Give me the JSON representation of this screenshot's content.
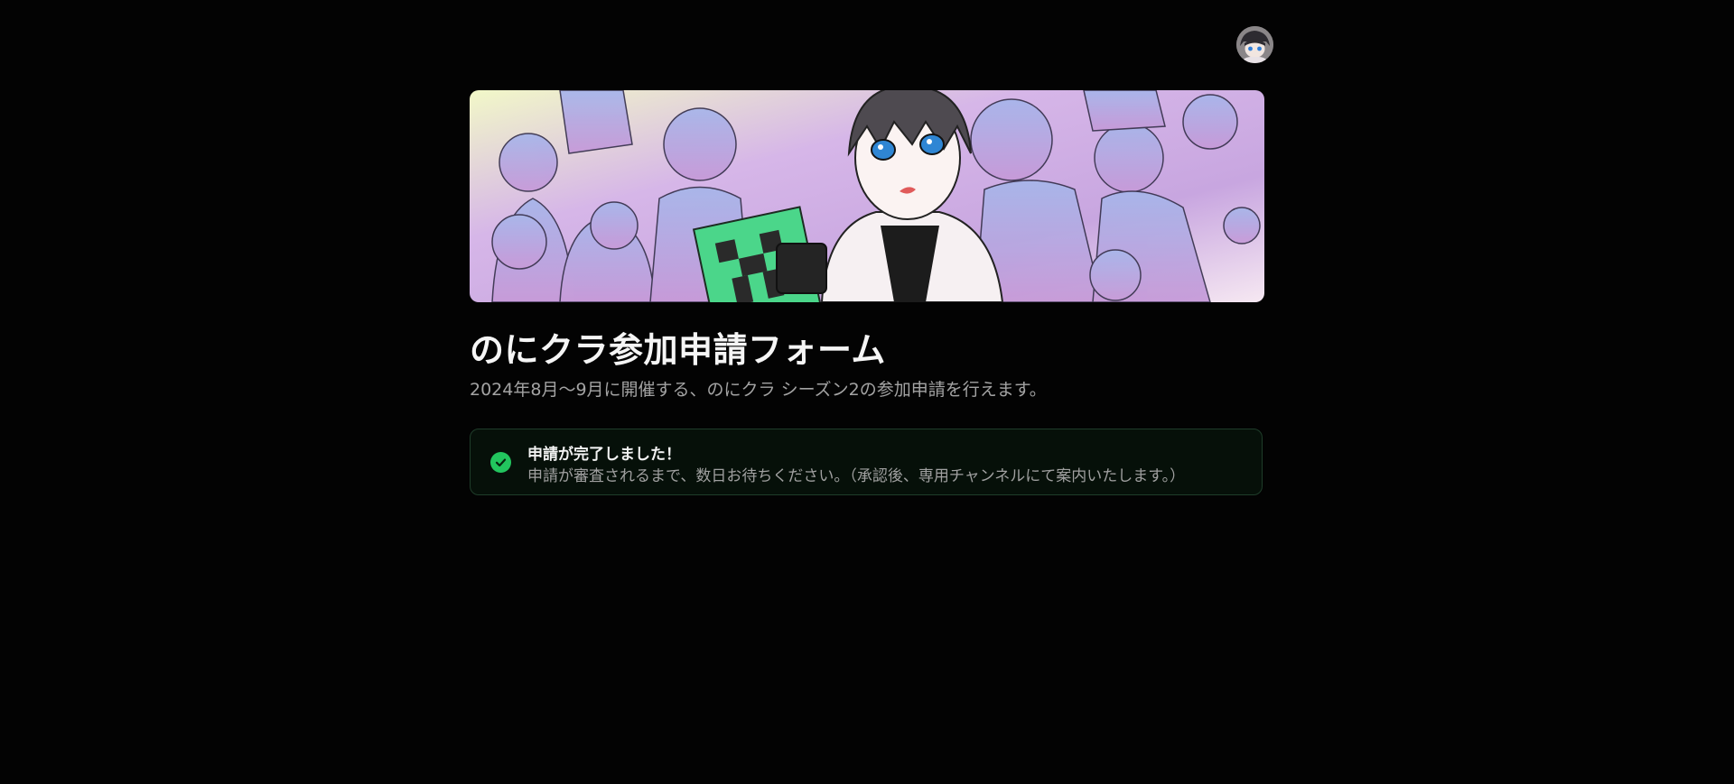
{
  "header": {
    "avatar_icon": "user-avatar-icon"
  },
  "banner": {
    "icon": "illustration-banner-image"
  },
  "form": {
    "title": "のにクラ参加申請フォーム",
    "subtitle": "2024年8月〜9月に開催する、のにクラ シーズン2の参加申請を行えます。"
  },
  "alert": {
    "icon": "check-circle-icon",
    "title": "申請が完了しました！",
    "description": "申請が審査されるまで、数日お待ちください。（承認後、専用チャンネルにて案内いたします。）",
    "color": "#22c55e"
  },
  "colors": {
    "background": "#030303",
    "success": "#22c55e"
  }
}
